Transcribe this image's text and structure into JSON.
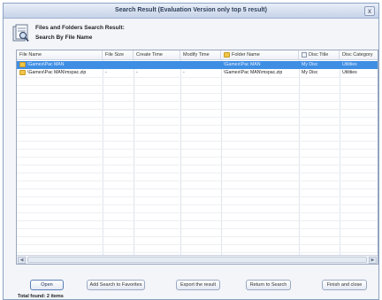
{
  "window": {
    "title": "Search Result (Evaluation Version only top 5 result)",
    "close_glyph": "x"
  },
  "header": {
    "line1": "Files and Folders Search Result:",
    "line2": "Search By File Name",
    "icon": "search-results-icon"
  },
  "table": {
    "columns": [
      "File Name",
      "File Size",
      "Create Time",
      "Modify Time",
      "Folder Name",
      "Disc Title",
      "Disc Category"
    ],
    "rows": [
      {
        "file_name": "\\Games\\Pac MAN",
        "file_size": "",
        "create_time": "",
        "modify_time": "",
        "folder_name": "\\Games\\Pac MAN",
        "disc_title": "My Disc",
        "disc_category": "Utilities",
        "selected": true
      },
      {
        "file_name": "\\Games\\Pac MAN\\mspac.zip",
        "file_size": "-",
        "create_time": "-",
        "modify_time": "-",
        "folder_name": "\\Games\\Pac MAN\\mspac.zip",
        "disc_title": "My Disc",
        "disc_category": "Utilities",
        "selected": false
      }
    ]
  },
  "buttons": {
    "open": "Open",
    "add_favorites": "Add Search to Favorites",
    "export": "Export the result",
    "return": "Return to Search",
    "finish": "Finish and close"
  },
  "status": {
    "total": "Total found: 2 items"
  },
  "colors": {
    "selection": "#3e8ee4",
    "title_text": "#2f3f5c"
  }
}
